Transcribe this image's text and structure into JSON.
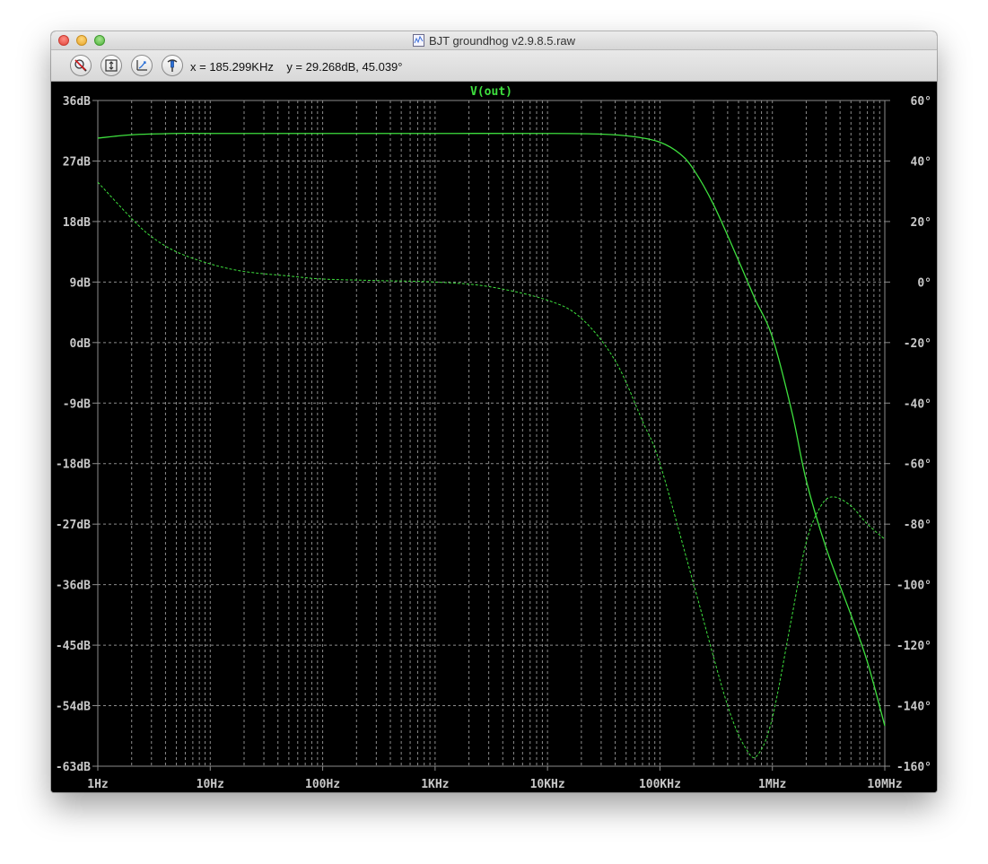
{
  "window": {
    "title": "BJT groundhog v2.9.8.5.raw"
  },
  "toolbar": {
    "buttons": [
      {
        "icon": "zoom-cancel-icon"
      },
      {
        "icon": "autorange-icon"
      },
      {
        "icon": "zoom-back-icon"
      },
      {
        "icon": "probe-icon"
      }
    ],
    "readout": "x = 185.299KHz    y = 29.268dB, 45.039°"
  },
  "colors": {
    "background": "#000000",
    "grid": "#8c8c8c",
    "trace": "#3ee03e",
    "tick_text": "#c8c8c8"
  },
  "chart_data": {
    "type": "line",
    "title": "V(out)",
    "x_scale": "log",
    "xlim": [
      1,
      10000000
    ],
    "x_ticks": [
      {
        "value": 1,
        "label": "1Hz"
      },
      {
        "value": 10,
        "label": "10Hz"
      },
      {
        "value": 100,
        "label": "100Hz"
      },
      {
        "value": 1000,
        "label": "1KHz"
      },
      {
        "value": 10000,
        "label": "10KHz"
      },
      {
        "value": 100000,
        "label": "100KHz"
      },
      {
        "value": 1000000,
        "label": "1MHz"
      },
      {
        "value": 10000000,
        "label": "10MHz"
      }
    ],
    "y_left": {
      "unit": "dB",
      "lim": [
        -63,
        36
      ],
      "ticks": [
        {
          "value": 36,
          "label": "36dB"
        },
        {
          "value": 27,
          "label": "27dB"
        },
        {
          "value": 18,
          "label": "18dB"
        },
        {
          "value": 9,
          "label": "9dB"
        },
        {
          "value": 0,
          "label": "0dB"
        },
        {
          "value": -9,
          "label": "-9dB"
        },
        {
          "value": -18,
          "label": "-18dB"
        },
        {
          "value": -27,
          "label": "-27dB"
        },
        {
          "value": -36,
          "label": "-36dB"
        },
        {
          "value": -45,
          "label": "-45dB"
        },
        {
          "value": -54,
          "label": "-54dB"
        },
        {
          "value": -63,
          "label": "-63dB"
        }
      ]
    },
    "y_right": {
      "unit": "°",
      "lim": [
        -160,
        60
      ],
      "ticks": [
        {
          "value": 60,
          "label": "60°"
        },
        {
          "value": 40,
          "label": "40°"
        },
        {
          "value": 20,
          "label": "20°"
        },
        {
          "value": 0,
          "label": "0°"
        },
        {
          "value": -20,
          "label": "-20°"
        },
        {
          "value": -40,
          "label": "-40°"
        },
        {
          "value": -60,
          "label": "-60°"
        },
        {
          "value": -80,
          "label": "-80°"
        },
        {
          "value": -100,
          "label": "-100°"
        },
        {
          "value": -120,
          "label": "-120°"
        },
        {
          "value": -140,
          "label": "-140°"
        },
        {
          "value": -160,
          "label": "-160°"
        }
      ]
    },
    "grid": true,
    "series": [
      {
        "name": "magnitude",
        "axis": "left",
        "style": "solid",
        "x": [
          1,
          2,
          5,
          10,
          100,
          1000,
          10000,
          30000,
          60000,
          100000,
          150000,
          200000,
          300000,
          500000,
          700000,
          1000000,
          1500000,
          2000000,
          3000000,
          5000000,
          7000000,
          10000000
        ],
        "y": [
          30.4,
          30.9,
          31.1,
          31.1,
          31.1,
          31.1,
          31.1,
          31.0,
          30.6,
          29.8,
          28.1,
          25.7,
          20.5,
          12.2,
          6.5,
          0.8,
          -10.5,
          -20.5,
          -30.5,
          -40.5,
          -47.5,
          -57.0
        ]
      },
      {
        "name": "phase",
        "axis": "right",
        "style": "dashed",
        "x": [
          1,
          2,
          3,
          5,
          10,
          20,
          50,
          100,
          300,
          1000,
          3000,
          10000,
          20000,
          40000,
          70000,
          100000,
          200000,
          400000,
          600000,
          750000,
          1000000,
          1500000,
          2000000,
          2700000,
          3500000,
          5000000,
          7000000,
          10000000
        ],
        "y": [
          33,
          21,
          15,
          10,
          6,
          3.5,
          2,
          1,
          0.5,
          0,
          -1.5,
          -6,
          -12,
          -26,
          -46,
          -60,
          -100,
          -140,
          -155,
          -156,
          -144,
          -110,
          -86,
          -74,
          -71,
          -74,
          -80,
          -85
        ]
      }
    ]
  }
}
